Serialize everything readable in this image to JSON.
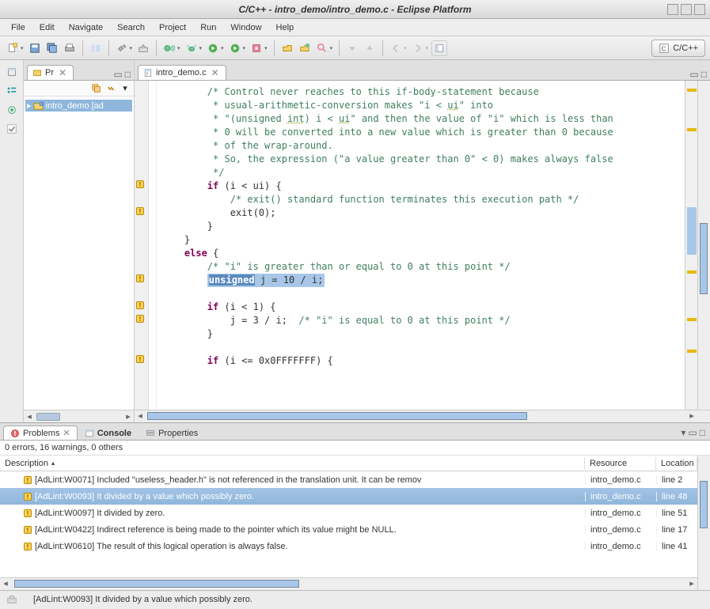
{
  "window": {
    "title": "C/C++ - intro_demo/intro_demo.c - Eclipse Platform"
  },
  "menu": [
    "File",
    "Edit",
    "Navigate",
    "Search",
    "Project",
    "Run",
    "Window",
    "Help"
  ],
  "perspective": {
    "label": "C/C++"
  },
  "project_panel": {
    "tab_label": "Pr",
    "tree_item": "intro_demo [ad"
  },
  "editor": {
    "tab_label": "intro_demo.c",
    "code_lines": [
      {
        "indent": 8,
        "type": "comment",
        "text": "/* Control never reaches to this if-body-statement because"
      },
      {
        "indent": 8,
        "type": "comment",
        "text": " * usual-arithmetic-conversion makes \"i < ui\" into",
        "ul": [
          "ui"
        ]
      },
      {
        "indent": 8,
        "type": "comment",
        "text": " * \"(unsigned int) i < ui\" and then the value of \"i\" which is less than",
        "ul": [
          "int",
          "ui"
        ]
      },
      {
        "indent": 8,
        "type": "comment",
        "text": " * 0 will be converted into a new value which is greater than 0 because"
      },
      {
        "indent": 8,
        "type": "comment",
        "text": " * of the wrap-around."
      },
      {
        "indent": 8,
        "type": "comment",
        "text": " * So, the expression (\"a value greater than 0\" < 0) makes always false"
      },
      {
        "indent": 8,
        "type": "comment",
        "text": " */"
      },
      {
        "indent": 8,
        "type": "code",
        "raw": "<span class='code-keyword'>if</span> (i &lt; ui) {",
        "gutter": "warn"
      },
      {
        "indent": 12,
        "type": "comment",
        "text": "/* exit() standard function terminates this execution path */"
      },
      {
        "indent": 12,
        "type": "code",
        "raw": "exit(0);",
        "gutter": "warn"
      },
      {
        "indent": 8,
        "type": "code",
        "raw": "}"
      },
      {
        "indent": 4,
        "type": "code",
        "raw": "}"
      },
      {
        "indent": 4,
        "type": "code",
        "raw": "<span class='code-keyword'>else</span> {"
      },
      {
        "indent": 8,
        "type": "comment",
        "text": "/* \"i\" is greater than or equal to 0 at this point */"
      },
      {
        "indent": 8,
        "type": "highlight",
        "raw": "<span class='code-keyword' style='color:#fff;background:#5a8abd;'>unsigned</span> j = 10 / i;",
        "gutter": "warn"
      },
      {
        "indent": 0,
        "type": "blank"
      },
      {
        "indent": 8,
        "type": "code",
        "raw": "<span class='code-keyword'>if</span> (i &lt; 1) {",
        "gutter": "warn"
      },
      {
        "indent": 12,
        "type": "code",
        "raw": "j = 3 / i;  <span class='code-comment'>/* \"i\" is equal to 0 at this point */</span>",
        "gutter": "warn"
      },
      {
        "indent": 8,
        "type": "code",
        "raw": "}"
      },
      {
        "indent": 0,
        "type": "blank"
      },
      {
        "indent": 8,
        "type": "code",
        "raw": "<span class='code-keyword'>if</span> (i &lt;= 0x0FFFFFFF) {",
        "gutter": "warn"
      }
    ]
  },
  "problems": {
    "tabs": [
      {
        "label": "Problems",
        "active": true,
        "bold": false
      },
      {
        "label": "Console",
        "active": false,
        "bold": true
      },
      {
        "label": "Properties",
        "active": false,
        "bold": false
      }
    ],
    "summary": "0 errors, 16 warnings, 0 others",
    "columns": [
      "Description",
      "Resource",
      "Location"
    ],
    "rows": [
      {
        "desc": "[AdLint:W0071] Included \"useless_header.h\" is not referenced in the translation unit. It can be remov",
        "res": "intro_demo.c",
        "loc": "line 2",
        "selected": false
      },
      {
        "desc": "[AdLint:W0093] It divided by a value which possibly zero.",
        "res": "intro_demo.c",
        "loc": "line 48",
        "selected": true
      },
      {
        "desc": "[AdLint:W0097] It divided by zero.",
        "res": "intro_demo.c",
        "loc": "line 51",
        "selected": false
      },
      {
        "desc": "[AdLint:W0422] Indirect reference is being made to the pointer which its value might be NULL.",
        "res": "intro_demo.c",
        "loc": "line 17",
        "selected": false
      },
      {
        "desc": "[AdLint:W0610] The result of this logical operation is always false.",
        "res": "intro_demo.c",
        "loc": "line 41",
        "selected": false
      }
    ]
  },
  "statusbar": {
    "message": "[AdLint:W0093] It divided by a value which possibly zero."
  }
}
